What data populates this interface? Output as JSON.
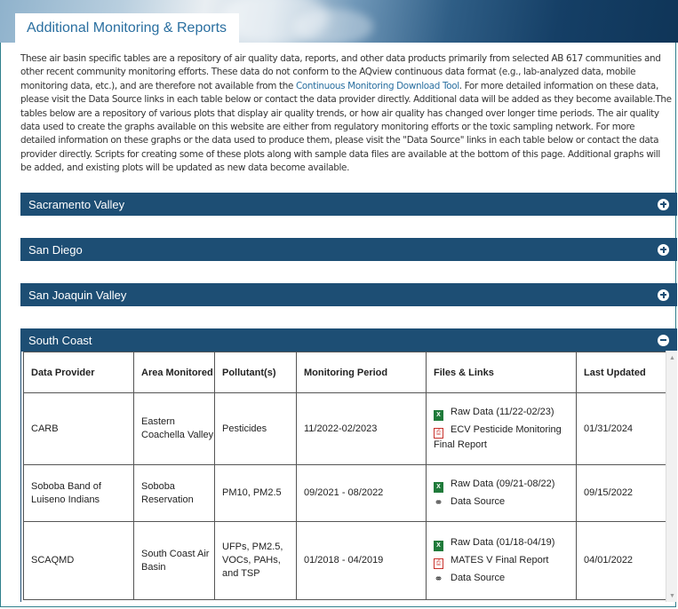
{
  "header": {
    "title": "Additional Monitoring & Reports"
  },
  "intro": {
    "part1": "These air basin specific tables are a repository of air quality data, reports, and other data products primarily from selected AB 617 communities and other recent community monitoring efforts. These data do not conform to the AQview continuous data format (e.g., lab-analyzed data, mobile monitoring data, etc.), and are therefore not available from the ",
    "link": "Continuous Monitoring Download Tool",
    "part2": ". For more detailed information on these data, please visit the Data Source links in each table below or contact the data provider directly. Additional data will be added as they become available.The tables below are a repository of various plots that display air quality trends, or how air quality has changed over longer time periods. The air quality data used to create the graphs available on this website are either from regulatory monitoring efforts or the toxic sampling network. For more detailed information on these graphs or the data used to produce them, please visit the \"Data Source\" links in each table below or contact the data provider directly. Scripts for creating some of these plots along with sample data files are available at the bottom of this page. Additional graphs will be added, and existing plots will be updated as new data become available."
  },
  "sections": [
    {
      "label": "Sacramento Valley",
      "state": "collapsed"
    },
    {
      "label": "San Diego",
      "state": "collapsed"
    },
    {
      "label": "San Joaquin Valley",
      "state": "collapsed"
    },
    {
      "label": "South Coast",
      "state": "expanded"
    }
  ],
  "table": {
    "headers": [
      "Data Provider",
      "Area Monitored",
      "Pollutant(s)",
      "Monitoring Period",
      "Files & Links",
      "Last Updated"
    ],
    "rows": [
      {
        "provider": "CARB",
        "area": "Eastern Coachella Valley",
        "pollutants": "Pesticides",
        "period": "11/2022-02/2023",
        "files": [
          {
            "icon": "excel-icon",
            "text": "Raw Data (11/22-02/23)"
          },
          {
            "icon": "pdf-icon",
            "text": "ECV Pesticide Monitoring Final Report"
          }
        ],
        "updated": "01/31/2024"
      },
      {
        "provider": "Soboba Band of Luiseno Indians",
        "area": "Soboba Reservation",
        "pollutants": "PM10, PM2.5",
        "period": "09/2021 - 08/2022",
        "files": [
          {
            "icon": "excel-icon",
            "text": "Raw Data (09/21-08/22)"
          },
          {
            "icon": "link-icon",
            "text": "Data Source"
          }
        ],
        "updated": "09/15/2022"
      },
      {
        "provider": "SCAQMD",
        "area": "South Coast Air Basin",
        "pollutants": "UFPs, PM2.5, VOCs, PAHs, and TSP",
        "period": "01/2018 - 04/2019",
        "files": [
          {
            "icon": "excel-icon",
            "text": "Raw Data (01/18-04/19)"
          },
          {
            "icon": "pdf-icon",
            "text": "MATES V Final Report"
          },
          {
            "icon": "link-icon",
            "text": "Data Source"
          }
        ],
        "updated": "04/01/2022"
      }
    ]
  },
  "colors": {
    "accordion": "#1d4e74",
    "link": "#2a6fa0",
    "excel": "#1f7a3a",
    "pdf": "#c8302a"
  }
}
